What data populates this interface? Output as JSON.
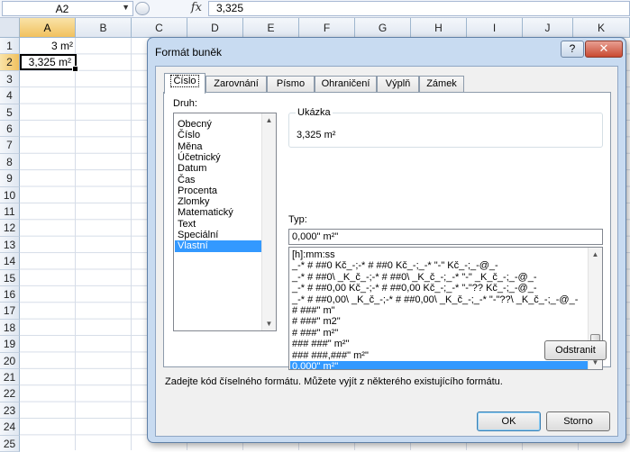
{
  "formula_bar": {
    "name_box": "A2",
    "formula_value": "3,325",
    "fx_icon": "fx-icon"
  },
  "sheet": {
    "columns": [
      "A",
      "B",
      "C",
      "D",
      "E",
      "F",
      "G",
      "H",
      "I",
      "J",
      "K"
    ],
    "rows": [
      "1",
      "2",
      "3",
      "4",
      "5",
      "6",
      "7",
      "8",
      "9",
      "10",
      "11",
      "12",
      "13",
      "14",
      "15",
      "16",
      "17",
      "18",
      "19",
      "20",
      "21",
      "22",
      "23",
      "24",
      "25"
    ],
    "selected_column": "A",
    "selected_row": "2",
    "cells": {
      "A1": "3 m²",
      "A2": "3,325 m²"
    }
  },
  "dialog": {
    "title": "Formát buněk",
    "help_label": "?",
    "close_label": "✕",
    "tabs": [
      "Číslo",
      "Zarovnání",
      "Písmo",
      "Ohraničení",
      "Výplň",
      "Zámek"
    ],
    "active_tab": "Číslo",
    "category_label": "Druh:",
    "categories": [
      "Obecný",
      "Číslo",
      "Měna",
      "Účetnický",
      "Datum",
      "Čas",
      "Procenta",
      "Zlomky",
      "Matematický",
      "Text",
      "Speciální",
      "Vlastní"
    ],
    "selected_category": "Vlastní",
    "sample_label": "Ukázka",
    "sample_value": "3,325 m²",
    "type_label": "Typ:",
    "type_value": "0,000\" m²\"",
    "formats": [
      "[h]:mm:ss",
      "_-* # ##0 Kč_-;-* # ##0 Kč_-;_-* \"-\" Kč_-;_-@_-",
      "_-* # ##0\\ _K_č_-;-* # ##0\\ _K_č_-;_-* \"-\" _K_č_-;_-@_-",
      "_-* # ##0,00 Kč_-;-* # ##0,00 Kč_-;_-* \"-\"?? Kč_-;_-@_-",
      "_-* # ##0,00\\ _K_č_-;-* # ##0,00\\ _K_č_-;_-* \"-\"??\\ _K_č_-;_-@_-",
      "# ###\" m\"",
      "# ###\" m2\"",
      "# ###\" m²\"",
      "### ###\" m²\"",
      "### ###,###\" m²\"",
      "0,000\" m²\""
    ],
    "selected_format": "0,000\" m²\"",
    "delete_button": "Odstranit",
    "hint_text": "Zadejte kód číselného formátu. Můžete vyjít z některého existujícího formátu.",
    "ok_button": "OK",
    "cancel_button": "Storno"
  },
  "colors": {
    "selection": "#3399ff",
    "dialog_frame": "#c8dbf1",
    "header_selected": "#f1c15e"
  }
}
